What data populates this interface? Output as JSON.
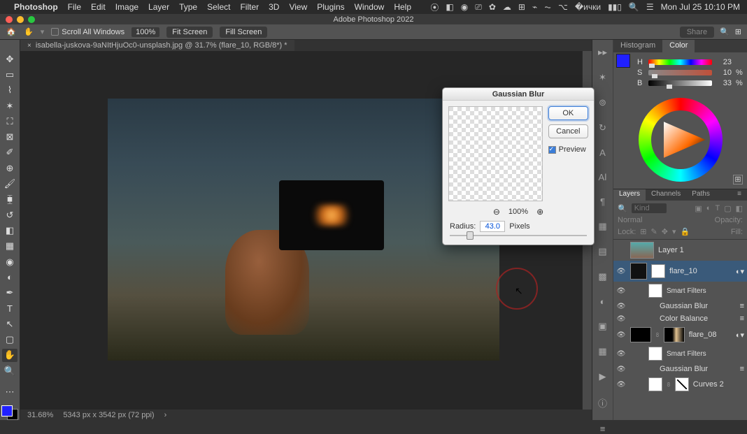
{
  "menubar": {
    "app": "Photoshop",
    "items": [
      "File",
      "Edit",
      "Image",
      "Layer",
      "Type",
      "Select",
      "Filter",
      "3D",
      "View",
      "Plugins",
      "Window",
      "Help"
    ],
    "clock": "Mon Jul 25  10:10 PM"
  },
  "titlebar": {
    "title": "Adobe Photoshop 2022"
  },
  "optbar": {
    "scroll_all": "Scroll All Windows",
    "zoom": "100%",
    "fit": "Fit Screen",
    "fill": "Fill Screen",
    "share": "Share"
  },
  "doctab": {
    "label": "isabella-juskova-9aNItHjuOc0-unsplash.jpg @ 31.7% (flare_10, RGB/8*) *",
    "close": "×"
  },
  "tools": [
    "move",
    "marquee",
    "lasso",
    "wand",
    "crop",
    "frame",
    "eyedrop",
    "heal",
    "brush",
    "stamp",
    "history",
    "eraser",
    "gradient",
    "blur",
    "dodge",
    "pen",
    "type",
    "path",
    "shape",
    "hand",
    "zoom"
  ],
  "status": {
    "zoom": "31.68%",
    "dims": "5343 px x 3542 px (72 ppi)",
    "arrow": "›"
  },
  "color_panel": {
    "tabs": {
      "histogram": "Histogram",
      "color": "Color"
    },
    "h": {
      "label": "H",
      "val": "23"
    },
    "s": {
      "label": "S",
      "val": "10",
      "pct": "%"
    },
    "b": {
      "label": "B",
      "val": "33",
      "pct": "%"
    }
  },
  "layers_panel": {
    "tabs": {
      "layers": "Layers",
      "channels": "Channels",
      "paths": "Paths"
    },
    "search_ph": "Kind",
    "blend": "Normal",
    "opacity_lbl": "Opacity:",
    "lock_lbl": "Lock:",
    "fill_lbl": "Fill:",
    "layers": [
      {
        "name": "Layer 1"
      },
      {
        "name": "flare_10"
      },
      {
        "name": "Smart Filters",
        "sf": true
      },
      {
        "name": "Gaussian Blur",
        "fx": true
      },
      {
        "name": "Color Balance",
        "fx": true
      },
      {
        "name": "flare_08"
      },
      {
        "name": "Smart Filters",
        "sf": true
      },
      {
        "name": "Gaussian Blur",
        "fx": true
      },
      {
        "name": "Curves 2"
      }
    ]
  },
  "dialog": {
    "title": "Gaussian Blur",
    "ok": "OK",
    "cancel": "Cancel",
    "preview": "Preview",
    "zoom": "100%",
    "radius_lbl": "Radius:",
    "radius_val": "43.0",
    "radius_unit": "Pixels"
  }
}
